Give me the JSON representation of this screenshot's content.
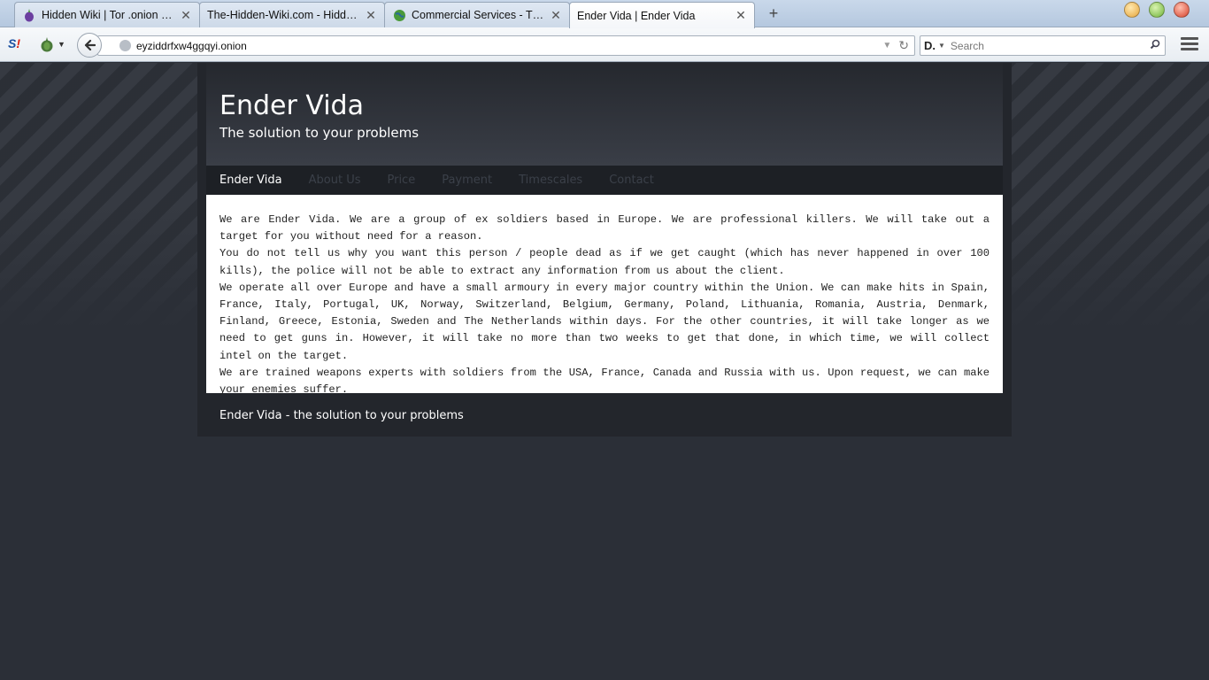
{
  "browser": {
    "tabs": [
      {
        "title": "Hidden Wiki | Tor .onion urls",
        "favicon": "onion-icon",
        "active": false
      },
      {
        "title": "The-Hidden-Wiki.com - Hidden Wiki",
        "favicon": "",
        "active": false
      },
      {
        "title": "Commercial Services - The Hidden Wiki",
        "favicon": "globe-icon",
        "active": false
      },
      {
        "title": "Ender Vida | Ender Vida",
        "favicon": "",
        "active": true
      }
    ],
    "url": "eyziddrfxw4ggqyi.onion",
    "search_placeholder": "Search",
    "search_engine_label": "D."
  },
  "site": {
    "title": "Ender Vida",
    "tagline": "The solution to your problems",
    "nav": [
      {
        "label": "Ender Vida",
        "active": true
      },
      {
        "label": "About Us",
        "active": false
      },
      {
        "label": "Price",
        "active": false
      },
      {
        "label": "Payment",
        "active": false
      },
      {
        "label": "Timescales",
        "active": false
      },
      {
        "label": "Contact",
        "active": false
      }
    ],
    "paragraphs": [
      "We are Ender Vida. We are a group of ex soldiers based in Europe. We are professional killers. We will take out a target for you without need for a reason.",
      "You do not tell us why you want this person / people dead as if we get caught (which has never happened in over 100 kills), the police will not be able to extract any information from us about the client.",
      "We operate all over Europe and have a small armoury in every major country within the Union. We can make hits in Spain, France, Italy, Portugal, UK, Norway, Switzerland, Belgium, Germany, Poland, Lithuania, Romania, Austria, Denmark, Finland, Greece, Estonia, Sweden and The Netherlands within days. For the other countries, it will take longer as we need to get guns in. However, it will take no more than two weeks to get that done, in which time, we will collect intel on the target.",
      "We are trained weapons experts with soldiers from the USA, France, Canada and Russia with us. Upon request, we can make your enemies suffer."
    ],
    "footer": "Ender Vida - the solution to your problems"
  },
  "colors": {
    "page_background": "#2b2f37",
    "nav_inactive": "#3b4049",
    "nav_active": "#ffffff"
  }
}
